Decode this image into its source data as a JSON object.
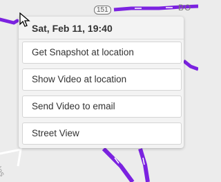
{
  "map": {
    "road_shield": "151",
    "edge_text": "BO",
    "corner_text": "los",
    "route_color": "#8a2be2"
  },
  "popup": {
    "title": "Sat, Feb 11, 19:40",
    "buttons": [
      {
        "label": "Get Snapshot at location"
      },
      {
        "label": "Show Video at location"
      },
      {
        "label": "Send Video to email"
      },
      {
        "label": "Street View"
      }
    ]
  },
  "cursor": {
    "icon": "arrow-pointer-icon"
  }
}
